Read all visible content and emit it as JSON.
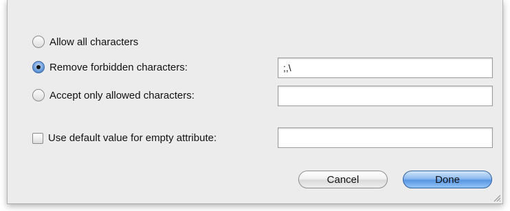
{
  "options": {
    "allow_all": {
      "label": "Allow all characters",
      "selected": false
    },
    "remove_forbidden": {
      "label": "Remove forbidden characters:",
      "selected": true,
      "value": ";,\\"
    },
    "accept_only": {
      "label": "Accept only allowed characters:",
      "selected": false,
      "value": ""
    }
  },
  "default_value": {
    "label": "Use default value for empty attribute:",
    "checked": false,
    "value": ""
  },
  "buttons": {
    "cancel": "Cancel",
    "done": "Done"
  }
}
